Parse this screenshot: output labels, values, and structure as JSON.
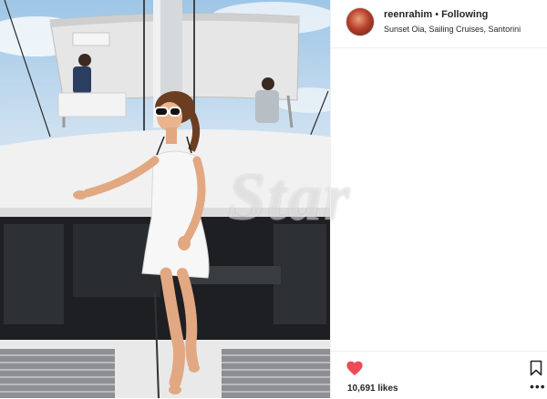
{
  "post": {
    "username": "reenrahim",
    "separator": "•",
    "follow_status": "Following",
    "location": "Sunset Oia, Sailing Cruises, Santorini",
    "likes": "10,691 likes",
    "watermark": "Star"
  },
  "icons": {
    "heart": "heart-icon",
    "bookmark": "bookmark-icon",
    "more": "more-options-icon"
  },
  "colors": {
    "heart": "#ed4956",
    "text": "#262626",
    "border": "#efefef"
  }
}
